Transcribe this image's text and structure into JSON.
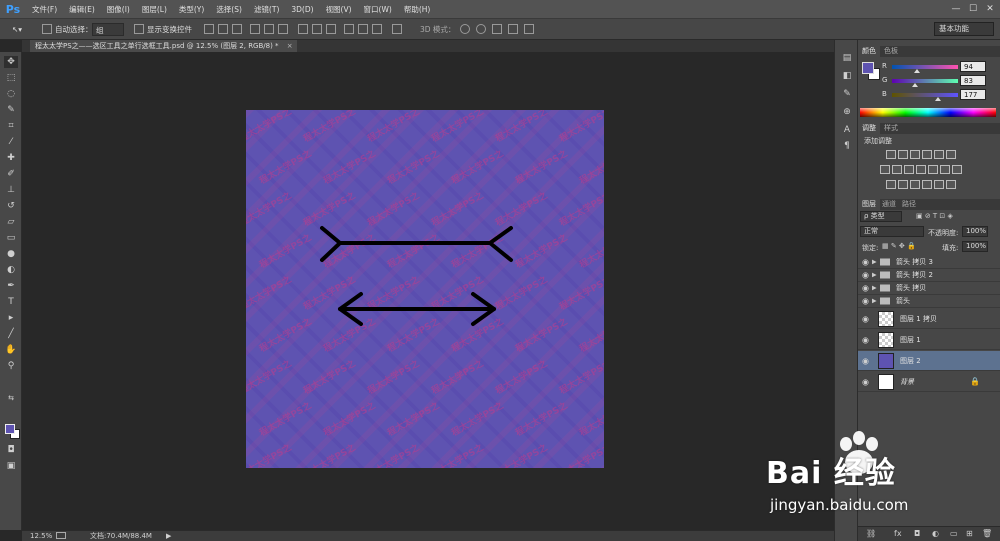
{
  "app": {
    "logo": "Ps"
  },
  "menu": [
    "文件(F)",
    "编辑(E)",
    "图像(I)",
    "图层(L)",
    "类型(Y)",
    "选择(S)",
    "滤镜(T)",
    "3D(D)",
    "视图(V)",
    "窗口(W)",
    "帮助(H)"
  ],
  "window_controls": {
    "minimize": "—",
    "maximize": "☐",
    "close": "✕"
  },
  "options": {
    "auto_select_label": "自动选择：",
    "auto_select_value": "组",
    "show_transform_label": "显示变换控件",
    "mode_3d_label": "3D 模式：",
    "workspace": "基本功能"
  },
  "document_tab": {
    "title": "程太太学PS之——选区工具之单行选框工具.psd @ 12.5% (图层 2, RGB/8) *",
    "close": "×"
  },
  "canvas": {
    "background_color": "#5e53b1",
    "watermark_text": "程太太学PS之"
  },
  "status": {
    "zoom": "12.5%",
    "doc_size": "文档:70.4M/88.4M"
  },
  "color_panel": {
    "tabs": [
      "颜色",
      "色板"
    ],
    "r_label": "R",
    "r": "94",
    "g_label": "G",
    "g": "83",
    "b_label": "B",
    "b": "177",
    "color_hex": "#5e53b1"
  },
  "adjustments_panel": {
    "tabs": [
      "调整",
      "样式"
    ],
    "title": "添加调整"
  },
  "layers_panel": {
    "tabs": [
      "图层",
      "通道",
      "路径"
    ],
    "filter_kind": "ρ 类型",
    "blend_mode": "正常",
    "opacity_label": "不透明度:",
    "opacity": "100%",
    "lock_label": "锁定:",
    "fill_label": "填充:",
    "fill": "100%",
    "layers": [
      {
        "name": "箭头 拷贝 3",
        "type": "group"
      },
      {
        "name": "箭头 拷贝 2",
        "type": "group"
      },
      {
        "name": "箭头 拷贝",
        "type": "group"
      },
      {
        "name": "箭头",
        "type": "group"
      },
      {
        "name": "图层 1 拷贝",
        "type": "layer"
      },
      {
        "name": "图层 1",
        "type": "layer"
      },
      {
        "name": "图层 2",
        "type": "layer",
        "selected": true
      },
      {
        "name": "背景",
        "type": "background"
      }
    ]
  },
  "watermark": {
    "text": "Bai 经验",
    "url": "jingyan.baidu.com"
  }
}
